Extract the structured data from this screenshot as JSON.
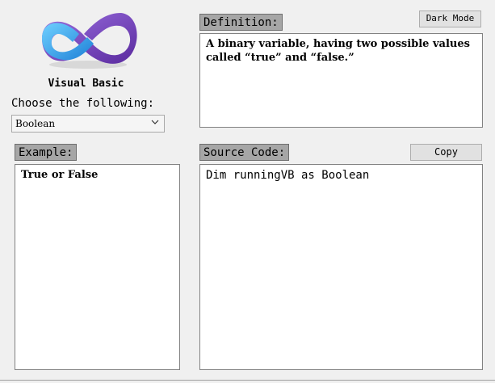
{
  "app": {
    "title": "Visual Basic",
    "choose_label": "Choose the following:"
  },
  "selector": {
    "selected": "Boolean"
  },
  "definition": {
    "label": "Definition:",
    "text": "A binary variable, having two possible values called “true” and “false.”"
  },
  "example": {
    "label": "Example:",
    "text": "True or False"
  },
  "source": {
    "label": "Source Code:",
    "text": "Dim runningVB as Boolean"
  },
  "buttons": {
    "dark_mode": "Dark Mode",
    "copy": "Copy"
  },
  "icons": {
    "logo": "visual-studio-infinity-logo-icon",
    "dropdown": "chevron-down-icon"
  },
  "colors": {
    "background": "#f0f0f0",
    "label_tag": "#a6a6a6",
    "logo_blue": "#2aa6e8",
    "logo_purple": "#7b3fbf"
  }
}
